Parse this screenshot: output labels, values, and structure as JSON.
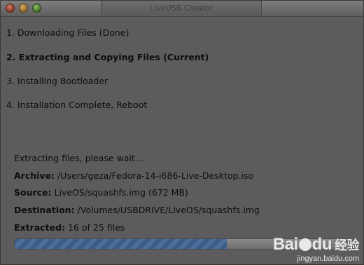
{
  "window": {
    "title": "LiveUSB Creator"
  },
  "steps": [
    {
      "label": "1. Downloading Files (Done)"
    },
    {
      "label": "2. Extracting and Copying Files (Current)"
    },
    {
      "label": "3. Installing Bootloader"
    },
    {
      "label": "4. Installation Complete, Reboot"
    }
  ],
  "status": {
    "message": "Extracting files, please wait...",
    "archive_label": "Archive:",
    "archive_value": "/Users/geza/Fedora-14-i686-Live-Desktop.iso",
    "source_label": "Source:",
    "source_value": "LiveOS/squashfs.img (672 MB)",
    "destination_label": "Destination:",
    "destination_value": "/Volumes/USBDRIVE/LiveOS/squashfs.img",
    "extracted_label": "Extracted:",
    "extracted_value": "16 of 25 files"
  },
  "progress": {
    "fraction": 0.64
  },
  "watermark": {
    "brand": "Bai",
    "brand_suffix": "du",
    "jingyan": "经验",
    "url": "jingyan.baidu.com"
  }
}
